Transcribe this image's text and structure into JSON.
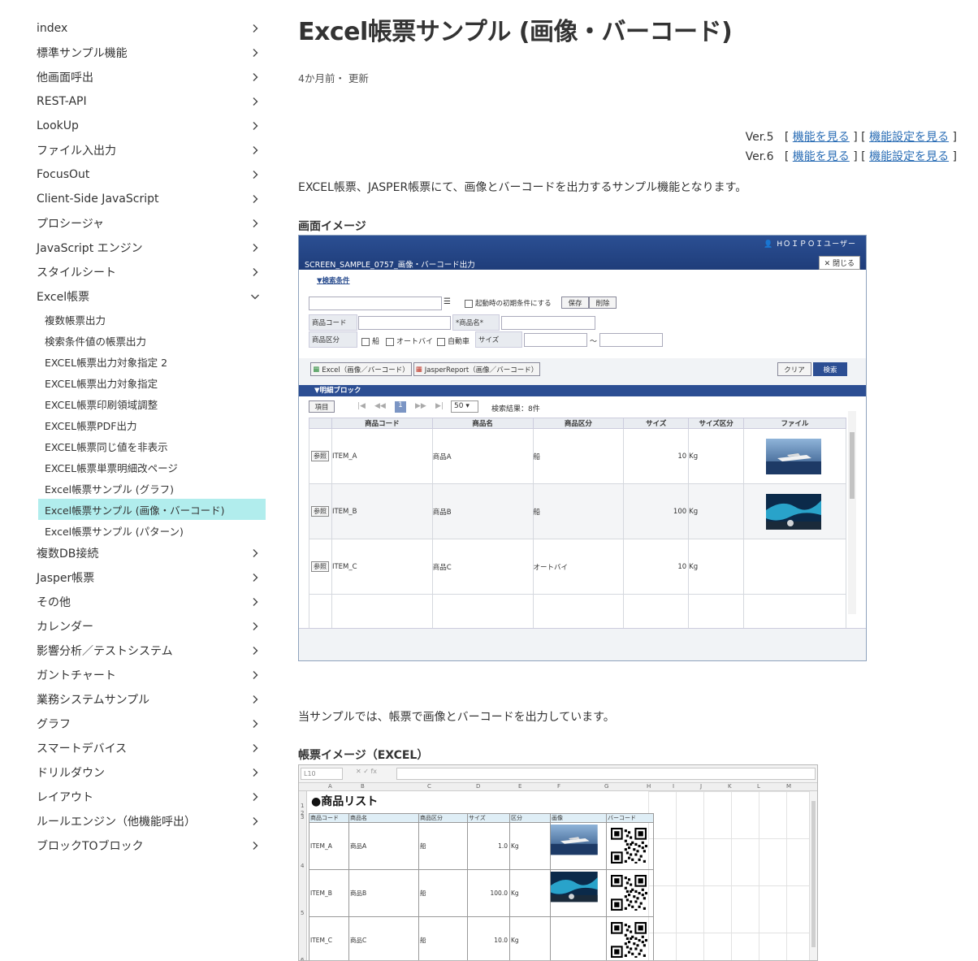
{
  "sidebar": {
    "items_top": [
      {
        "label": "index"
      },
      {
        "label": "標準サンプル機能"
      },
      {
        "label": "他画面呼出"
      },
      {
        "label": "REST-API"
      },
      {
        "label": "LookUp"
      },
      {
        "label": "ファイル入出力"
      },
      {
        "label": "FocusOut"
      },
      {
        "label": "Client-Side JavaScript"
      },
      {
        "label": "プロシージャ"
      },
      {
        "label": "JavaScript エンジン"
      },
      {
        "label": "スタイルシート"
      }
    ],
    "expanded": {
      "label": "Excel帳票"
    },
    "sub_items": [
      {
        "label": "複数帳票出力"
      },
      {
        "label": "検索条件値の帳票出力"
      },
      {
        "label": "EXCEL帳票出力対象指定 2"
      },
      {
        "label": "EXCEL帳票出力対象指定"
      },
      {
        "label": "EXCEL帳票印刷領域調整"
      },
      {
        "label": "EXCEL帳票PDF出力"
      },
      {
        "label": "EXCEL帳票同じ値を非表示"
      },
      {
        "label": "EXCEL帳票単票明細改ページ"
      },
      {
        "label": "Excel帳票サンプル (グラフ)"
      },
      {
        "label": "Excel帳票サンプル (画像・バーコード)"
      },
      {
        "label": "Excel帳票サンプル (パターン)"
      }
    ],
    "items_bottom": [
      {
        "label": "複数DB接続"
      },
      {
        "label": "Jasper帳票"
      },
      {
        "label": "その他"
      },
      {
        "label": "カレンダー"
      },
      {
        "label": "影響分析／テストシステム"
      },
      {
        "label": "ガントチャート"
      },
      {
        "label": "業務システムサンプル"
      },
      {
        "label": "グラフ"
      },
      {
        "label": "スマートデバイス"
      },
      {
        "label": "ドリルダウン"
      },
      {
        "label": "レイアウト"
      },
      {
        "label": "ルールエンジン（他機能呼出）"
      },
      {
        "label": "ブロックTOブロック"
      }
    ]
  },
  "page": {
    "title": "Excel帳票サンプル (画像・バーコード)",
    "meta": "4か月前・ 更新",
    "versions": [
      {
        "ver": "Ver.5",
        "link1": "機能を見る",
        "link2": "機能設定を見る"
      },
      {
        "ver": "Ver.6",
        "link1": "機能を見る",
        "link2": "機能設定を見る"
      }
    ],
    "intro": "EXCEL帳票、JASPER帳票にて、画像とバーコードを出力するサンプル機能となります。",
    "section1": "画面イメージ",
    "para2": "当サンプルでは、帳票で画像とバーコードを出力しています。",
    "section2": "帳票イメージ（EXCEL）"
  },
  "app": {
    "user": "HＯＩＰＯＩユーザー",
    "screen_title": "SCREEN_SAMPLE_0757_画像・バーコード出力",
    "close": "✕ 閉じる",
    "search_label": "▼検索条件",
    "initial_chk": "起動時の初期条件にする",
    "save": "保存",
    "delete": "削除",
    "product_code": "商品コード",
    "product_name": "*商品名*",
    "product_type": "商品区分",
    "opt_ship": "船",
    "opt_bike": "オートバイ",
    "opt_car": "自動車",
    "size": "サイズ",
    "tilde": "～",
    "btn_excel": "Excel（画像／バーコード）",
    "btn_jasper": "JasperReport（画像／バーコード）",
    "clear": "クリア",
    "search": "検索",
    "detail": "▼明細ブロック",
    "item_btn": "項目",
    "page": "1",
    "per_page": "50",
    "result": "検索結果：8件",
    "headers": [
      "",
      "商品コード",
      "商品名",
      "商品区分",
      "サイズ",
      "サイズ区分",
      "ファイル"
    ],
    "ref": "参照",
    "rows": [
      {
        "code": "ITEM_A",
        "name": "商品A",
        "type": "船",
        "size": "10",
        "unit": "Kg"
      },
      {
        "code": "ITEM_B",
        "name": "商品B",
        "type": "船",
        "size": "100",
        "unit": "Kg"
      },
      {
        "code": "ITEM_C",
        "name": "商品C",
        "type": "オートバイ",
        "size": "10",
        "unit": "Kg"
      }
    ]
  },
  "excel": {
    "namebox": "L10",
    "fx": "✕ ✓ fx",
    "cols": [
      "A",
      "B",
      "C",
      "D",
      "E",
      "F",
      "G",
      "H",
      "I",
      "J",
      "K",
      "L",
      "M"
    ],
    "rows_nums": [
      "1",
      "2",
      "3",
      "4",
      "5",
      "6"
    ],
    "title": "●商品リスト",
    "headers": [
      "商品コード",
      "商品名",
      "商品区分",
      "サイズ",
      "区分",
      "画像",
      "バーコード"
    ],
    "rows": [
      {
        "code": "ITEM_A",
        "name": "商品A",
        "type": "船",
        "size": "1.0",
        "unit": "Kg"
      },
      {
        "code": "ITEM_B",
        "name": "商品B",
        "type": "船",
        "size": "100.0",
        "unit": "Kg"
      },
      {
        "code": "ITEM_C",
        "name": "商品C",
        "type": "船",
        "size": "10.0",
        "unit": "Kg"
      }
    ]
  },
  "colors": {
    "active_bg": "#b1eded",
    "link": "#2a6db5",
    "app_header": "#1f3d7a"
  }
}
